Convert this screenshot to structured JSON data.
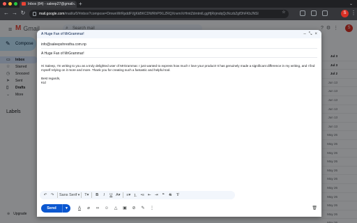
{
  "browser": {
    "tab_title": "Inbox (84) - saleep27@gmail...",
    "tab_close": "×",
    "new_tab": "+",
    "url_host": "mail.google.com",
    "url_rest": "/mail/u/0/#inbox?compose=DmwnWrRpddFVjjKkBKCDWRhPfXLZRQXnvmXrHmtZdmtmlLggHjRrjmdqQcNczbZgfDhFKbJNSl",
    "profile_initial": "S"
  },
  "gmail": {
    "logo_text": "Gmail",
    "search_placeholder": "Search mail",
    "avatar_initial": "S",
    "compose_label": "Compose",
    "nav": [
      {
        "label": "Inbox",
        "icon": "inbox-icon"
      },
      {
        "label": "Starred",
        "icon": "star-icon"
      },
      {
        "label": "Snoozed",
        "icon": "clock-icon"
      },
      {
        "label": "Sent",
        "icon": "send-icon"
      },
      {
        "label": "Drafts",
        "icon": "draft-icon"
      },
      {
        "label": "More",
        "icon": "chevron-down-icon"
      }
    ],
    "labels_title": "Labels",
    "upgrade_label": "Upgrade",
    "dates": [
      "Jul 3",
      "Jul 3",
      "Jul 2",
      "Jun 13",
      "Jun 13",
      "Jun 13",
      "Jun 13",
      "Jun 13",
      "Jun 13",
      "May 26",
      "May 26",
      "May 26",
      "May 26",
      "May 26",
      "May 26",
      "May 26",
      "May 26",
      "May 26",
      "May 26",
      "May 26"
    ]
  },
  "compose": {
    "header_title": "A Huge Fan of MrGrammar!",
    "to": "info@saleepshrestha.com.np",
    "subject": "A Huge Fan of MrGrammar!",
    "body_paragraph": "Hi Saleep, I'm writing to you as a truly delighted user of MrGrammar. I just wanted to express how much I love your product! It has genuinely made a significant difference in my writing, and I find myself relying on it more and more. Thank you for creating such a fantastic and helpful tool.",
    "closing": "Best regards,",
    "signature": "Kid",
    "font_name": "Sans Serif",
    "send_label": "Send"
  },
  "colors": {
    "accent": "#0b57d0",
    "compose_button": "#c2e7ff",
    "gmail_red": "#ea4335",
    "avatar": "#d93025"
  }
}
